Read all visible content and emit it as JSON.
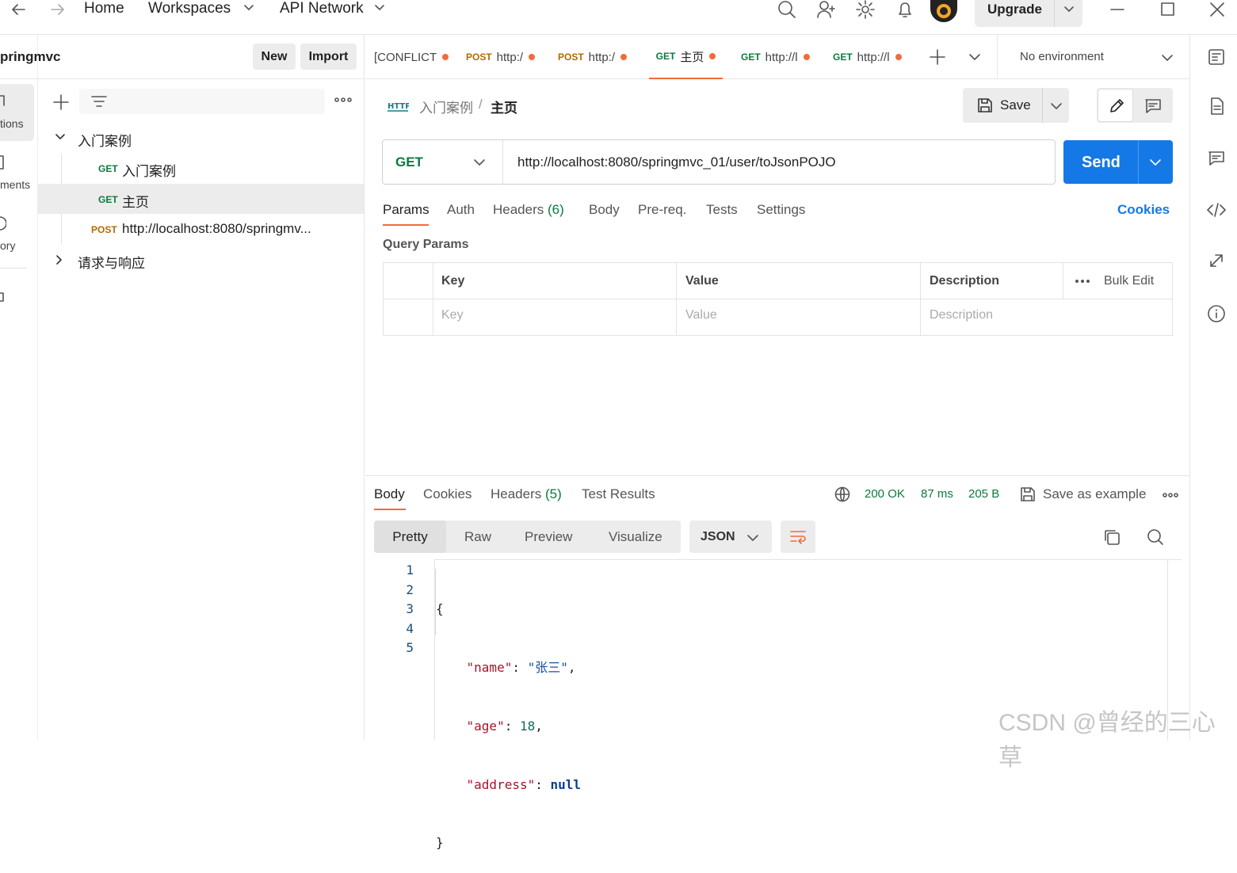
{
  "topbar": {
    "home": "Home",
    "workspaces": "Workspaces",
    "api_network": "API Network",
    "upgrade": "Upgrade"
  },
  "rail": {
    "items": [
      "tions",
      "ments",
      "ory"
    ]
  },
  "sidebar": {
    "workspace_name": "pringmvc",
    "new_label": "New",
    "import_label": "Import",
    "tree": [
      {
        "type": "folder",
        "label": "入门案例",
        "expanded": true
      },
      {
        "type": "request",
        "method": "GET",
        "label": "入门案例"
      },
      {
        "type": "request",
        "method": "GET",
        "label": "主页",
        "selected": true
      },
      {
        "type": "request",
        "method": "POST",
        "label": "http://localhost:8080/springmv..."
      },
      {
        "type": "folder",
        "label": "请求与响应",
        "expanded": false
      }
    ]
  },
  "tabs": [
    {
      "method": "",
      "label": "[CONFLICT",
      "dirty": true
    },
    {
      "method": "POST",
      "label": "http:/",
      "dirty": true
    },
    {
      "method": "POST",
      "label": "http:/",
      "dirty": true
    },
    {
      "method": "GET",
      "label": "主页",
      "dirty": true,
      "active": true
    },
    {
      "method": "GET",
      "label": "http://l",
      "dirty": true
    },
    {
      "method": "GET",
      "label": "http://l",
      "dirty": true
    }
  ],
  "environment": "No environment",
  "request": {
    "breadcrumb_parent": "入门案例",
    "breadcrumb_sep": "/",
    "breadcrumb_current": "主页",
    "save_label": "Save",
    "method": "GET",
    "url": "http://localhost:8080/springmvc_01/user/toJsonPOJO",
    "send_label": "Send",
    "subtabs": [
      "Params",
      "Auth",
      "Headers",
      "Body",
      "Pre-req.",
      "Tests",
      "Settings"
    ],
    "headers_count": "(6)",
    "cookies_label": "Cookies",
    "query_params_title": "Query Params",
    "table": {
      "col_key": "Key",
      "col_value": "Value",
      "col_description": "Description",
      "bulk_edit": "Bulk Edit",
      "ph_key": "Key",
      "ph_value": "Value",
      "ph_description": "Description"
    }
  },
  "response": {
    "tabs": [
      "Body",
      "Cookies",
      "Headers",
      "Test Results"
    ],
    "headers_count": "(5)",
    "status": "200 OK",
    "time": "87 ms",
    "size": "205 B",
    "save_example": "Save as example",
    "views": [
      "Pretty",
      "Raw",
      "Preview",
      "Visualize"
    ],
    "format": "JSON",
    "lines": [
      "1",
      "2",
      "3",
      "4",
      "5"
    ],
    "json": {
      "open": "{",
      "k1": "\"name\"",
      "v1": "\"张三\"",
      "k2": "\"age\"",
      "v2": "18",
      "k3": "\"address\"",
      "v3": "null",
      "close": "}"
    }
  },
  "watermark": "CSDN @曾经的三心草",
  "colors": {
    "send": "#1479e6",
    "accent": "#f26b3a",
    "get": "#0b7a3e",
    "post": "#b26a00",
    "status_ok": "#0b7a3e"
  }
}
